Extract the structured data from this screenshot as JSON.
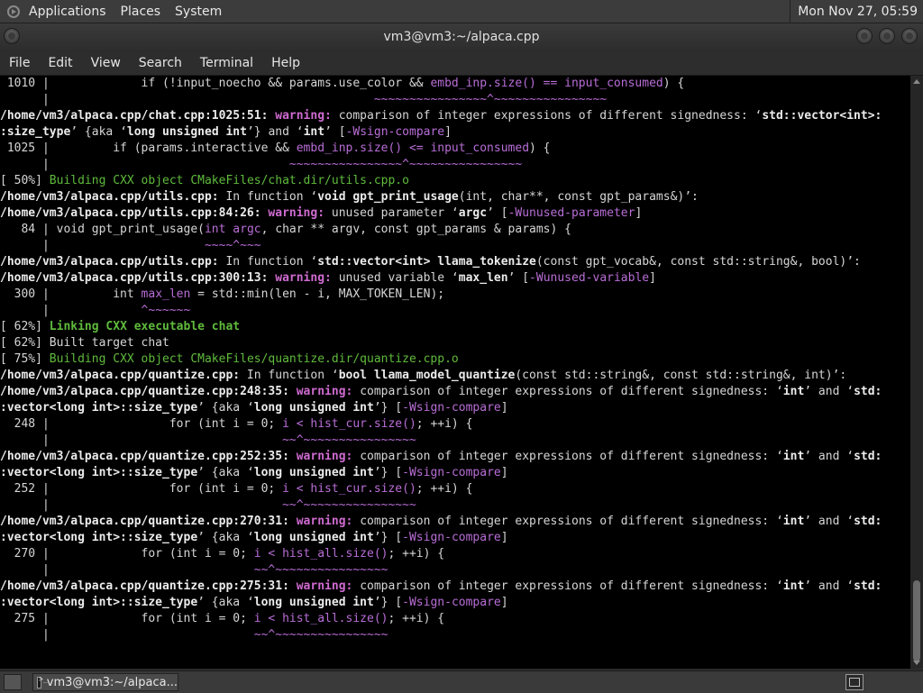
{
  "top_panel": {
    "menus": [
      "Applications",
      "Places",
      "System"
    ],
    "clock": "Mon Nov 27, 05:59"
  },
  "window": {
    "title": "vm3@vm3:~/alpaca.cpp"
  },
  "menubar": [
    "File",
    "Edit",
    "View",
    "Search",
    "Terminal",
    "Help"
  ],
  "terminal_lines": [
    [
      {
        "t": " 1010 |             if (!input_noecho && params.use_color && "
      },
      {
        "t": "embd_inp.size() == input_consumed",
        "c": "m"
      },
      {
        "t": ") {"
      }
    ],
    [
      {
        "t": "      |                                              "
      },
      {
        "t": "~~~~~~~~~~~~~~~~^~~~~~~~~~~~~~~~~",
        "c": "m"
      }
    ],
    [
      {
        "t": "/home/vm3/alpaca.cpp/chat.cpp:1025:51: ",
        "c": "b"
      },
      {
        "t": "warning: ",
        "c": "w"
      },
      {
        "t": "comparison of integer expressions of different signedness: ‘"
      },
      {
        "t": "std::vector<int>:",
        "c": "b"
      }
    ],
    [
      {
        "t": ":size_type",
        "c": "b"
      },
      {
        "t": "’ {aka ‘"
      },
      {
        "t": "long unsigned int",
        "c": "b"
      },
      {
        "t": "’} and ‘"
      },
      {
        "t": "int",
        "c": "b"
      },
      {
        "t": "’ ["
      },
      {
        "t": "-Wsign-compare",
        "c": "m"
      },
      {
        "t": "]"
      }
    ],
    [
      {
        "t": " 1025 |         if (params.interactive && "
      },
      {
        "t": "embd_inp.size() <= input_consumed",
        "c": "m"
      },
      {
        "t": ") {"
      }
    ],
    [
      {
        "t": "      |                                  "
      },
      {
        "t": "~~~~~~~~~~~~~~~~^~~~~~~~~~~~~~~~~",
        "c": "m"
      }
    ],
    [
      {
        "t": "[ 50%] "
      },
      {
        "t": "Building CXX object CMakeFiles/chat.dir/utils.cpp.o",
        "c": "g"
      }
    ],
    [
      {
        "t": "/home/vm3/alpaca.cpp/utils.cpp:",
        "c": "b"
      },
      {
        "t": " In function ‘"
      },
      {
        "t": "void gpt_print_usage",
        "c": "b"
      },
      {
        "t": "(int, char**, const gpt_params&)’:"
      }
    ],
    [
      {
        "t": "/home/vm3/alpaca.cpp/utils.cpp:84:26: ",
        "c": "b"
      },
      {
        "t": "warning: ",
        "c": "w"
      },
      {
        "t": "unused parameter ‘"
      },
      {
        "t": "argc",
        "c": "b"
      },
      {
        "t": "’ ["
      },
      {
        "t": "-Wunused-parameter",
        "c": "m"
      },
      {
        "t": "]"
      }
    ],
    [
      {
        "t": "   84 | void gpt_print_usage("
      },
      {
        "t": "int argc",
        "c": "m"
      },
      {
        "t": ", char ** argv, const gpt_params & params) {"
      }
    ],
    [
      {
        "t": "      |                      "
      },
      {
        "t": "~~~~^~~~",
        "c": "m"
      }
    ],
    [
      {
        "t": "/home/vm3/alpaca.cpp/utils.cpp:",
        "c": "b"
      },
      {
        "t": " In function ‘"
      },
      {
        "t": "std::vector<int> llama_tokenize",
        "c": "b"
      },
      {
        "t": "(const gpt_vocab&, const std::string&, bool)’:"
      }
    ],
    [
      {
        "t": "/home/vm3/alpaca.cpp/utils.cpp:300:13: ",
        "c": "b"
      },
      {
        "t": "warning: ",
        "c": "w"
      },
      {
        "t": "unused variable ‘"
      },
      {
        "t": "max_len",
        "c": "b"
      },
      {
        "t": "’ ["
      },
      {
        "t": "-Wunused-variable",
        "c": "m"
      },
      {
        "t": "]"
      }
    ],
    [
      {
        "t": "  300 |         int "
      },
      {
        "t": "max_len",
        "c": "m"
      },
      {
        "t": " = std::min(len - i, MAX_TOKEN_LEN);"
      }
    ],
    [
      {
        "t": "      |             "
      },
      {
        "t": "^~~~~~~",
        "c": "m"
      }
    ],
    [
      {
        "t": "[ 62%] "
      },
      {
        "t": "Linking CXX executable chat",
        "c": "gb"
      }
    ],
    [
      {
        "t": "[ 62%] Built target chat"
      }
    ],
    [
      {
        "t": "[ 75%] "
      },
      {
        "t": "Building CXX object CMakeFiles/quantize.dir/quantize.cpp.o",
        "c": "g"
      }
    ],
    [
      {
        "t": "/home/vm3/alpaca.cpp/quantize.cpp:",
        "c": "b"
      },
      {
        "t": " In function ‘"
      },
      {
        "t": "bool llama_model_quantize",
        "c": "b"
      },
      {
        "t": "(const std::string&, const std::string&, int)’:"
      }
    ],
    [
      {
        "t": "/home/vm3/alpaca.cpp/quantize.cpp:248:35: ",
        "c": "b"
      },
      {
        "t": "warning: ",
        "c": "w"
      },
      {
        "t": "comparison of integer expressions of different signedness: ‘"
      },
      {
        "t": "int",
        "c": "b"
      },
      {
        "t": "’ and ‘"
      },
      {
        "t": "std:",
        "c": "b"
      }
    ],
    [
      {
        "t": ":vector<long int>::size_type",
        "c": "b"
      },
      {
        "t": "’ {aka ‘"
      },
      {
        "t": "long unsigned int",
        "c": "b"
      },
      {
        "t": "’} ["
      },
      {
        "t": "-Wsign-compare",
        "c": "m"
      },
      {
        "t": "]"
      }
    ],
    [
      {
        "t": "  248 |                 for (int i = 0; "
      },
      {
        "t": "i < hist_cur.size()",
        "c": "m"
      },
      {
        "t": "; ++i) {"
      }
    ],
    [
      {
        "t": "      |                                 "
      },
      {
        "t": "~~^~~~~~~~~~~~~~~~~",
        "c": "m"
      }
    ],
    [
      {
        "t": "/home/vm3/alpaca.cpp/quantize.cpp:252:35: ",
        "c": "b"
      },
      {
        "t": "warning: ",
        "c": "w"
      },
      {
        "t": "comparison of integer expressions of different signedness: ‘"
      },
      {
        "t": "int",
        "c": "b"
      },
      {
        "t": "’ and ‘"
      },
      {
        "t": "std:",
        "c": "b"
      }
    ],
    [
      {
        "t": ":vector<long int>::size_type",
        "c": "b"
      },
      {
        "t": "’ {aka ‘"
      },
      {
        "t": "long unsigned int",
        "c": "b"
      },
      {
        "t": "’} ["
      },
      {
        "t": "-Wsign-compare",
        "c": "m"
      },
      {
        "t": "]"
      }
    ],
    [
      {
        "t": "  252 |                 for (int i = 0; "
      },
      {
        "t": "i < hist_cur.size()",
        "c": "m"
      },
      {
        "t": "; ++i) {"
      }
    ],
    [
      {
        "t": "      |                                 "
      },
      {
        "t": "~~^~~~~~~~~~~~~~~~~",
        "c": "m"
      }
    ],
    [
      {
        "t": "/home/vm3/alpaca.cpp/quantize.cpp:270:31: ",
        "c": "b"
      },
      {
        "t": "warning: ",
        "c": "w"
      },
      {
        "t": "comparison of integer expressions of different signedness: ‘"
      },
      {
        "t": "int",
        "c": "b"
      },
      {
        "t": "’ and ‘"
      },
      {
        "t": "std:",
        "c": "b"
      }
    ],
    [
      {
        "t": ":vector<long int>::size_type",
        "c": "b"
      },
      {
        "t": "’ {aka ‘"
      },
      {
        "t": "long unsigned int",
        "c": "b"
      },
      {
        "t": "’} ["
      },
      {
        "t": "-Wsign-compare",
        "c": "m"
      },
      {
        "t": "]"
      }
    ],
    [
      {
        "t": "  270 |             for (int i = 0; "
      },
      {
        "t": "i < hist_all.size()",
        "c": "m"
      },
      {
        "t": "; ++i) {"
      }
    ],
    [
      {
        "t": "      |                             "
      },
      {
        "t": "~~^~~~~~~~~~~~~~~~~",
        "c": "m"
      }
    ],
    [
      {
        "t": "/home/vm3/alpaca.cpp/quantize.cpp:275:31: ",
        "c": "b"
      },
      {
        "t": "warning: ",
        "c": "w"
      },
      {
        "t": "comparison of integer expressions of different signedness: ‘"
      },
      {
        "t": "int",
        "c": "b"
      },
      {
        "t": "’ and ‘"
      },
      {
        "t": "std:",
        "c": "b"
      }
    ],
    [
      {
        "t": ":vector<long int>::size_type",
        "c": "b"
      },
      {
        "t": "’ {aka ‘"
      },
      {
        "t": "long unsigned int",
        "c": "b"
      },
      {
        "t": "’} ["
      },
      {
        "t": "-Wsign-compare",
        "c": "m"
      },
      {
        "t": "]"
      }
    ],
    [
      {
        "t": "  275 |             for (int i = 0; "
      },
      {
        "t": "i < hist_all.size()",
        "c": "m"
      },
      {
        "t": "; ++i) {"
      }
    ],
    [
      {
        "t": "      |                             "
      },
      {
        "t": "~~^~~~~~~~~~~~~~~~~",
        "c": "m"
      }
    ]
  ],
  "taskbar": {
    "task_label": "vm3@vm3:~/alpaca..."
  },
  "colors": {
    "warning": "#cf6bd1",
    "highlight": "#b86dd6",
    "progress": "#5fbb3c"
  }
}
